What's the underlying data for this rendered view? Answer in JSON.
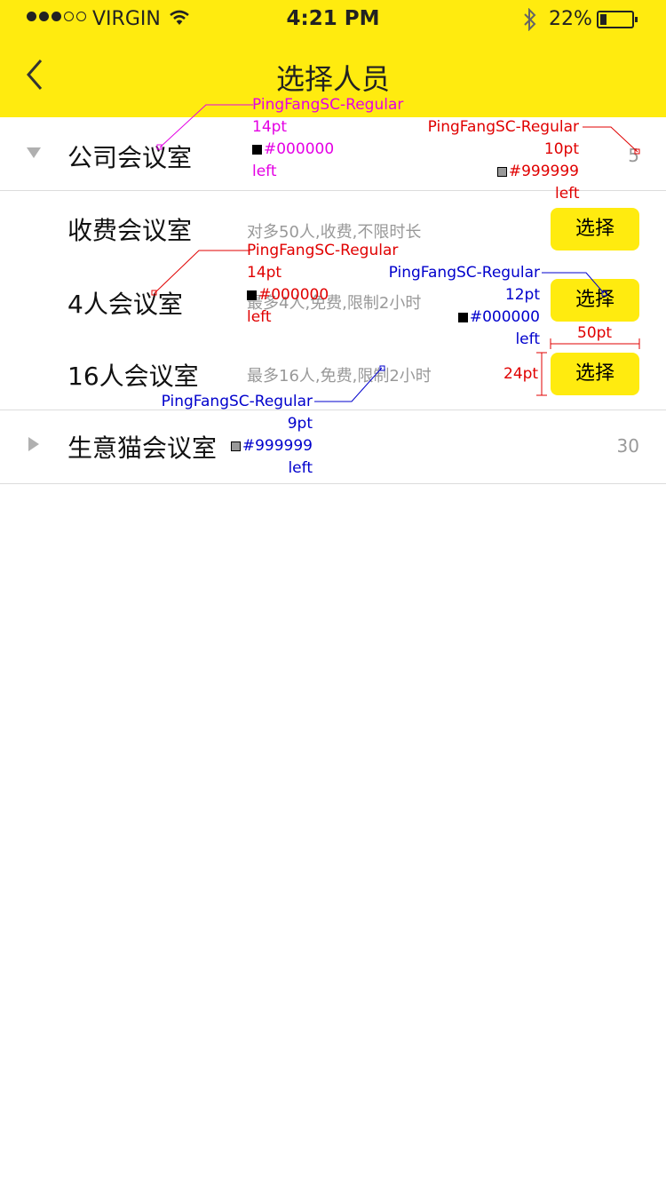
{
  "status_bar": {
    "carrier": "VIRGIN",
    "time": "4:21 PM",
    "battery": "22%",
    "battery_level": 0.22
  },
  "nav": {
    "title": "选择人员",
    "back_icon": "chevron-left-icon"
  },
  "groups": [
    {
      "name": "公司会议室",
      "count": "5",
      "expanded": true,
      "rooms": [
        {
          "name": "收费会议室",
          "desc": "对多50人,收费,不限时长",
          "button": "选择"
        },
        {
          "name": "4人会议室",
          "desc": "最多4人,免费,限制2小时",
          "button": "选择"
        },
        {
          "name": "16人会议室",
          "desc": "最多16人,免费,限制2小时",
          "button": "选择"
        }
      ]
    },
    {
      "name": "生意猫会议室",
      "count": "30",
      "expanded": false
    }
  ],
  "annotations": {
    "group_font": {
      "font": "PingFangSC-Regular",
      "size": "14pt",
      "color": "#000000",
      "align": "left"
    },
    "count_font": {
      "font": "PingFangSC-Regular",
      "size": "10pt",
      "color": "#999999",
      "align": "left"
    },
    "room_font": {
      "font": "PingFangSC-Regular",
      "size": "14pt",
      "color": "#000000",
      "align": "left"
    },
    "button_font": {
      "font": "PingFangSC-Regular",
      "size": "12pt",
      "color": "#000000",
      "align": "left"
    },
    "desc_font": {
      "font": "PingFangSC-Regular",
      "size": "9pt",
      "color": "#999999",
      "align": "left"
    },
    "button_width": "50pt",
    "button_height": "24pt"
  },
  "colors": {
    "header": "#ffeb0f",
    "button": "#ffeb0f",
    "annotation_magenta": "#e400e4",
    "annotation_red": "#e00000",
    "annotation_blue": "#0000cc"
  }
}
